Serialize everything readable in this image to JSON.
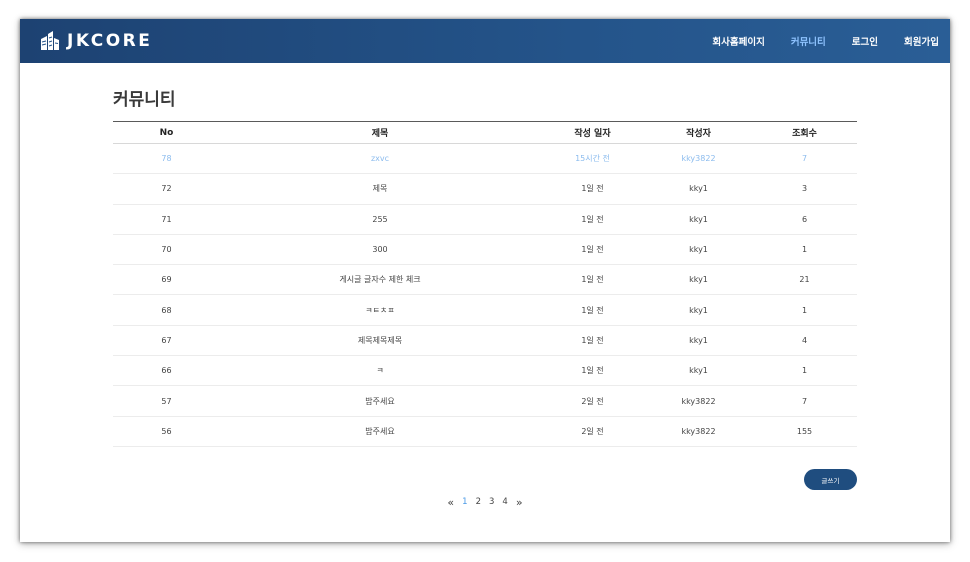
{
  "brand": {
    "logo_text": "JKCORE"
  },
  "nav": {
    "items": [
      {
        "label": "회사홈페이지",
        "active": false
      },
      {
        "label": "커뮤니티",
        "active": true
      },
      {
        "label": "로그인",
        "active": false
      },
      {
        "label": "회원가입",
        "active": false
      }
    ]
  },
  "page": {
    "title": "커뮤니티"
  },
  "table": {
    "headers": [
      "No",
      "제목",
      "작성 일자",
      "작성자",
      "조회수"
    ],
    "rows": [
      {
        "no": "78",
        "title": "zxvc",
        "date": "15시간 전",
        "author": "kky3822",
        "views": "7",
        "highlight": true
      },
      {
        "no": "72",
        "title": "제목",
        "date": "1일 전",
        "author": "kky1",
        "views": "3"
      },
      {
        "no": "71",
        "title": "255",
        "date": "1일 전",
        "author": "kky1",
        "views": "6"
      },
      {
        "no": "70",
        "title": "300",
        "date": "1일 전",
        "author": "kky1",
        "views": "1"
      },
      {
        "no": "69",
        "title": "게시글 글자수 제한 체크",
        "date": "1일 전",
        "author": "kky1",
        "views": "21"
      },
      {
        "no": "68",
        "title": "ㅋㅌㅊㅍ",
        "date": "1일 전",
        "author": "kky1",
        "views": "1"
      },
      {
        "no": "67",
        "title": "제목제목제목",
        "date": "1일 전",
        "author": "kky1",
        "views": "4"
      },
      {
        "no": "66",
        "title": "ㅋ",
        "date": "1일 전",
        "author": "kky1",
        "views": "1"
      },
      {
        "no": "57",
        "title": "밥주세요",
        "date": "2일 전",
        "author": "kky3822",
        "views": "7"
      },
      {
        "no": "56",
        "title": "밥주세요",
        "date": "2일 전",
        "author": "kky3822",
        "views": "155"
      }
    ]
  },
  "write_button": {
    "label": "글쓰기"
  },
  "pagination": {
    "prev": "«",
    "next": "»",
    "pages": [
      "1",
      "2",
      "3",
      "4"
    ],
    "current": "1"
  },
  "colors": {
    "header_start": "#1d4272",
    "header_end": "#2a5e96",
    "nav_active": "#8fc3ff",
    "row_highlight": "#8cbcee",
    "button": "#1f4d7f",
    "page_active": "#4a9ae6"
  }
}
